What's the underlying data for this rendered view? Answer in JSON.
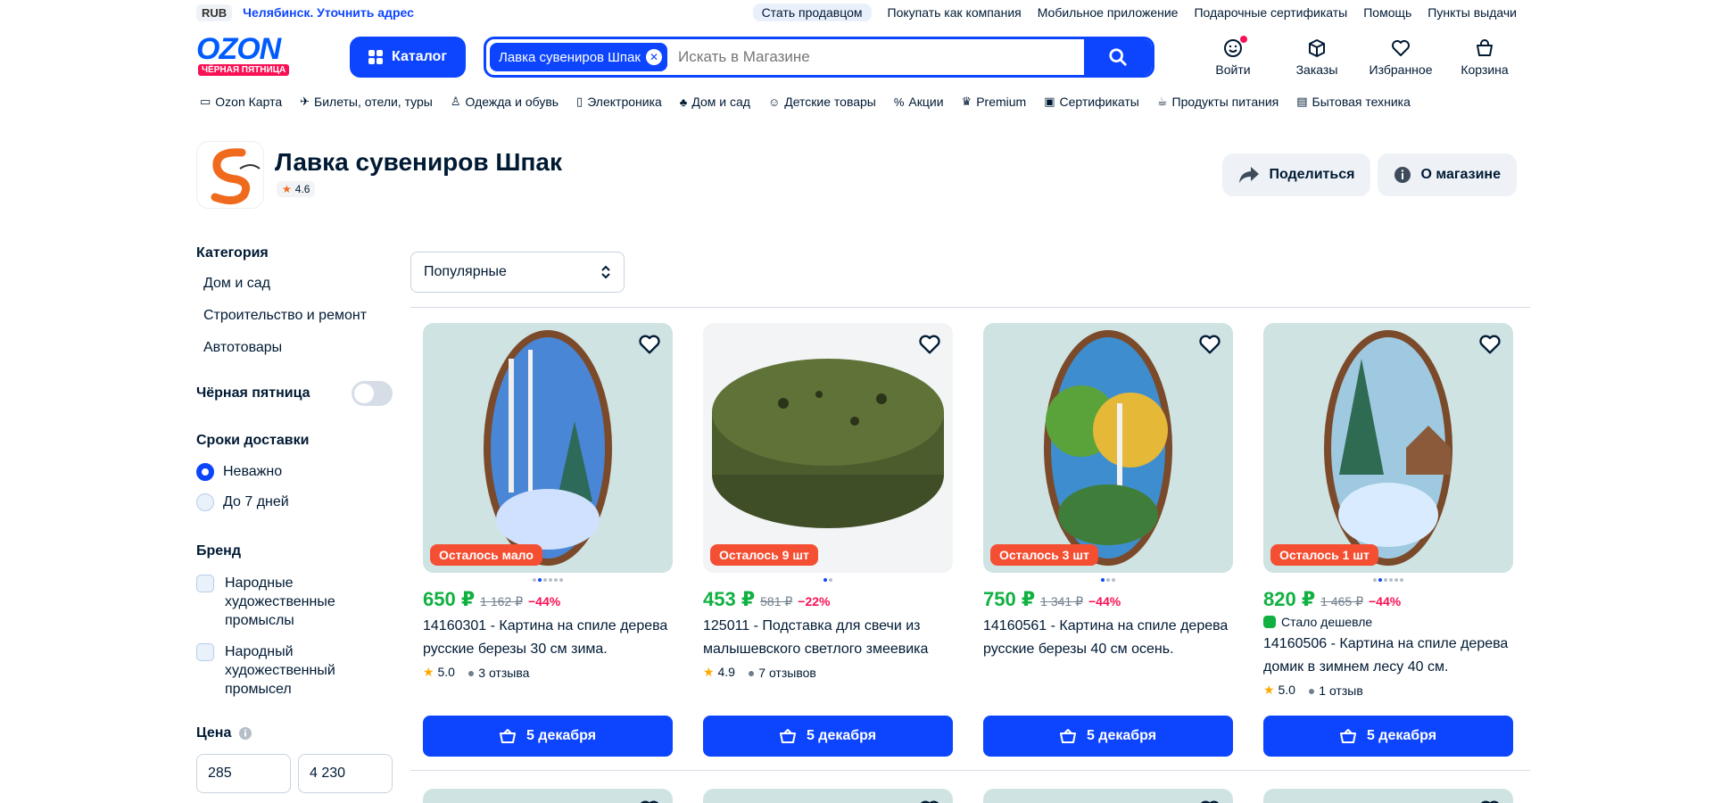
{
  "topbar": {
    "currency": "RUB",
    "city": "Челябинск. Уточнить адрес",
    "links": [
      "Стать продавцом",
      "Покупать как компания",
      "Мобильное приложение",
      "Подарочные сертификаты",
      "Помощь",
      "Пункты выдачи"
    ]
  },
  "header": {
    "logo_text": "OZON",
    "logo_sub": "ЧЁРНАЯ ПЯТНИЦА",
    "catalog_label": "Каталог",
    "search_chip": "Лавка сувениров Шпак",
    "search_placeholder": "Искать в Магазине",
    "icons": [
      {
        "label": "Войти",
        "icon": "smile-icon"
      },
      {
        "label": "Заказы",
        "icon": "box-icon"
      },
      {
        "label": "Избранное",
        "icon": "heart-icon"
      },
      {
        "label": "Корзина",
        "icon": "bag-icon"
      }
    ]
  },
  "catnav": [
    "Ozon Карта",
    "Билеты, отели, туры",
    "Одежда и обувь",
    "Электроника",
    "Дом и сад",
    "Детские товары",
    "Акции",
    "Premium",
    "Сертификаты",
    "Продукты питания",
    "Бытовая техника"
  ],
  "store": {
    "name": "Лавка сувениров Шпак",
    "rating": "4.6",
    "share_label": "Поделиться",
    "about_label": "О магазине"
  },
  "sidebar": {
    "category_title": "Категория",
    "categories": [
      "Дом и сад",
      "Строительство и ремонт",
      "Автотовары"
    ],
    "black_friday_label": "Чёрная пятница",
    "delivery_title": "Сроки доставки",
    "delivery_options": [
      "Неважно",
      "До 7 дней"
    ],
    "brand_title": "Бренд",
    "brands": [
      "Народные художественные промыслы",
      "Народный художественный промысел"
    ],
    "price_title": "Цена",
    "price_min": "285",
    "price_max": "4 230"
  },
  "sort": {
    "selected": "Популярные"
  },
  "products": [
    {
      "badge": "Осталось мало",
      "price": "650 ₽",
      "old_price": "1 162 ₽",
      "discount": "−44%",
      "title": "14160301 - Картина на спиле дерева русские березы 30 см зима.",
      "rating": "5.0",
      "reviews": "3 отзыва",
      "cheaper": "",
      "delivery": "5 декабря",
      "dots": 6,
      "active_dot": 1
    },
    {
      "badge": "Осталось 9 шт",
      "price": "453 ₽",
      "old_price": "581 ₽",
      "discount": "−22%",
      "title": "125011 - Подставка для свечи из малышевского светлого змеевика",
      "rating": "4.9",
      "reviews": "7 отзывов",
      "cheaper": "",
      "delivery": "5 декабря",
      "dots": 2,
      "active_dot": 0
    },
    {
      "badge": "Осталось 3 шт",
      "price": "750 ₽",
      "old_price": "1 341 ₽",
      "discount": "−44%",
      "title": "14160561 - Картина на спиле дерева русские березы 40 см осень.",
      "rating": "",
      "reviews": "",
      "cheaper": "",
      "delivery": "5 декабря",
      "dots": 3,
      "active_dot": 0
    },
    {
      "badge": "Осталось 1 шт",
      "price": "820 ₽",
      "old_price": "1 465 ₽",
      "discount": "−44%",
      "title": "14160506 - Картина на спиле дерева домик в зимнем лесу 40 см.",
      "rating": "5.0",
      "reviews": "1 отзыв",
      "cheaper": "Стало дешевле",
      "delivery": "5 декабря",
      "dots": 6,
      "active_dot": 1
    }
  ],
  "colors": {
    "accent": "#0d45ff",
    "price": "#10b140",
    "discount": "#f91155",
    "badge": "#f44f33"
  }
}
